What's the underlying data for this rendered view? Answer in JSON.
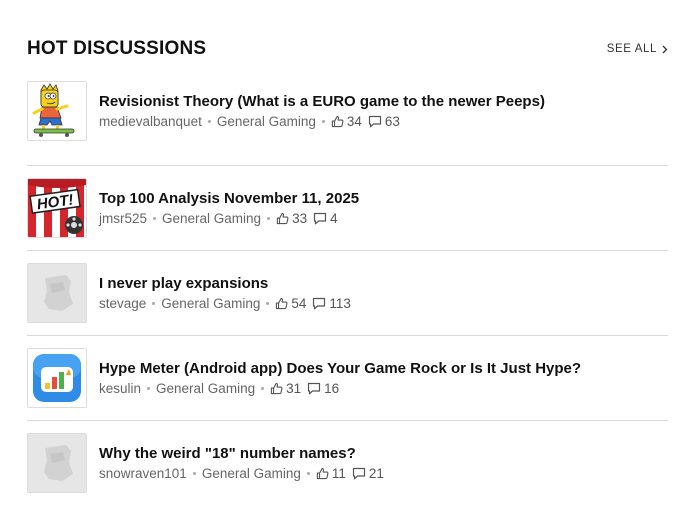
{
  "header": {
    "title": "HOT DISCUSSIONS",
    "see_all": "SEE ALL"
  },
  "colors": {
    "text": "#111111",
    "meta": "#666666",
    "divider": "#d9d9d9",
    "placeholder_bg": "#e6e6e6"
  },
  "threads": [
    {
      "title": "Revisionist Theory (What is a EURO game to the newer Peeps)",
      "user": "medievalbanquet",
      "forum": "General Gaming",
      "thumbs": "34",
      "comments": "63",
      "thumbnail": "skateboarder-avatar"
    },
    {
      "title": "Top 100 Analysis November 11, 2025",
      "user": "jmsr525",
      "forum": "General Gaming",
      "thumbs": "33",
      "comments": "4",
      "thumbnail": "hot-stripes-avatar",
      "thumbnail_text": "HOT!"
    },
    {
      "title": "I never play expansions",
      "user": "stevage",
      "forum": "General Gaming",
      "thumbs": "54",
      "comments": "113",
      "thumbnail": "placeholder-meeple-avatar"
    },
    {
      "title": "Hype Meter (Android app) Does Your Game Rock or Is It Just Hype?",
      "user": "kesulin",
      "forum": "General Gaming",
      "thumbs": "31",
      "comments": "16",
      "thumbnail": "hype-meter-app-icon"
    },
    {
      "title": "Why the weird \"18\" number names?",
      "user": "snowraven101",
      "forum": "General Gaming",
      "thumbs": "11",
      "comments": "21",
      "thumbnail": "placeholder-meeple-avatar"
    }
  ]
}
